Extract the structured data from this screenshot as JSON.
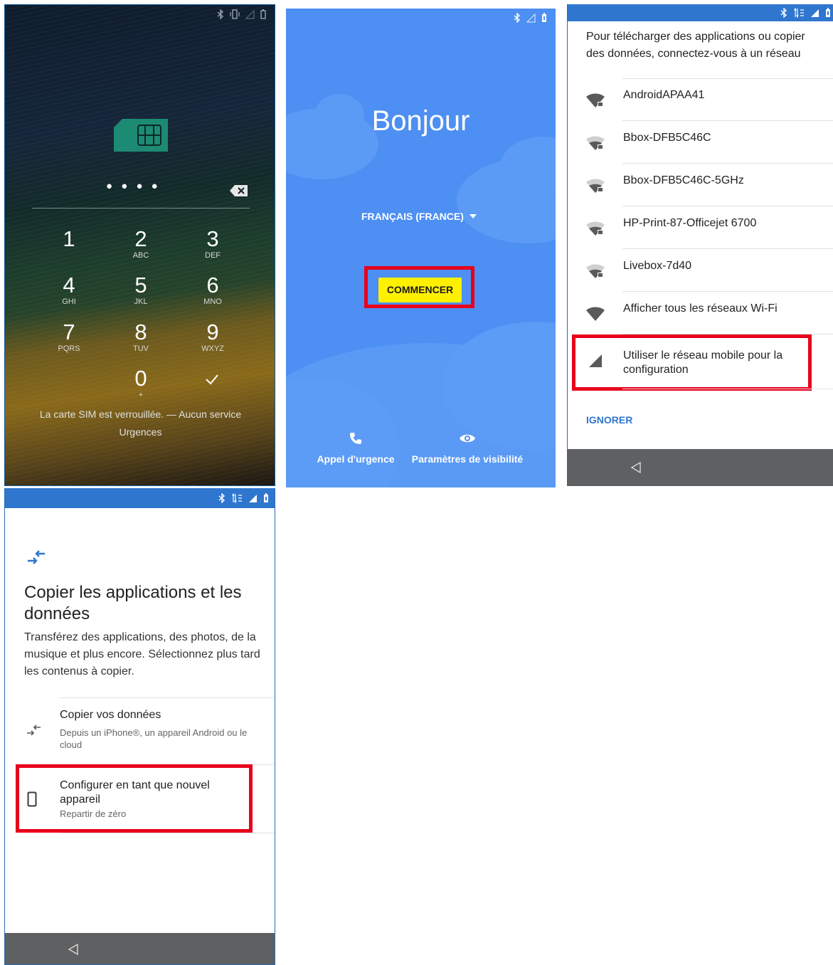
{
  "lock_screen": {
    "pin_dots": "● ● ● ●",
    "keys": [
      {
        "num": "1",
        "letters": ""
      },
      {
        "num": "2",
        "letters": "ABC"
      },
      {
        "num": "3",
        "letters": "DEF"
      },
      {
        "num": "4",
        "letters": "GHI"
      },
      {
        "num": "5",
        "letters": "JKL"
      },
      {
        "num": "6",
        "letters": "MNO"
      },
      {
        "num": "7",
        "letters": "PQRS"
      },
      {
        "num": "8",
        "letters": "TUV"
      },
      {
        "num": "9",
        "letters": "WXYZ"
      },
      {
        "num": "0",
        "letters": "+"
      }
    ],
    "status_message": "La carte SIM est verrouillée. — Aucun service",
    "emergency_label": "Urgences",
    "icons": [
      "sim-card-icon",
      "backspace-icon",
      "check-icon"
    ]
  },
  "welcome_screen": {
    "title": "Bonjour",
    "language": "FRANÇAIS (FRANCE)",
    "start_button": "COMMENCER",
    "emergency_call": "Appel d'urgence",
    "visibility_settings": "Paramètres de visibilité",
    "colors": {
      "background": "#4d8ff3",
      "button": "#fff000"
    }
  },
  "wifi_screen": {
    "header": "Pour télécharger des applications ou copier des données, connectez-vous à un réseau",
    "networks": [
      "AndroidAPAA41",
      "Bbox-DFB5C46C",
      "Bbox-DFB5C46C-5GHz",
      "HP-Print-87-Officejet 6700",
      "Livebox-7d40"
    ],
    "show_all": "Afficher tous les réseaux Wi-Fi",
    "mobile_network_option": "Utiliser le réseau mobile pour la configuration",
    "skip": "IGNORER"
  },
  "copy_screen": {
    "title": "Copier les applications et les données",
    "description": "Transférez des applications, des photos, de la musique et plus encore. Sélectionnez plus tard les contenus à copier.",
    "option_copy_title": "Copier vos données",
    "option_copy_subtitle": "Depuis un iPhone®, un appareil Android ou le cloud",
    "option_new_title": "Configurer en tant que nouvel appareil",
    "option_new_subtitle": "Repartir de zéro"
  },
  "highlight_color": "#e8001c"
}
